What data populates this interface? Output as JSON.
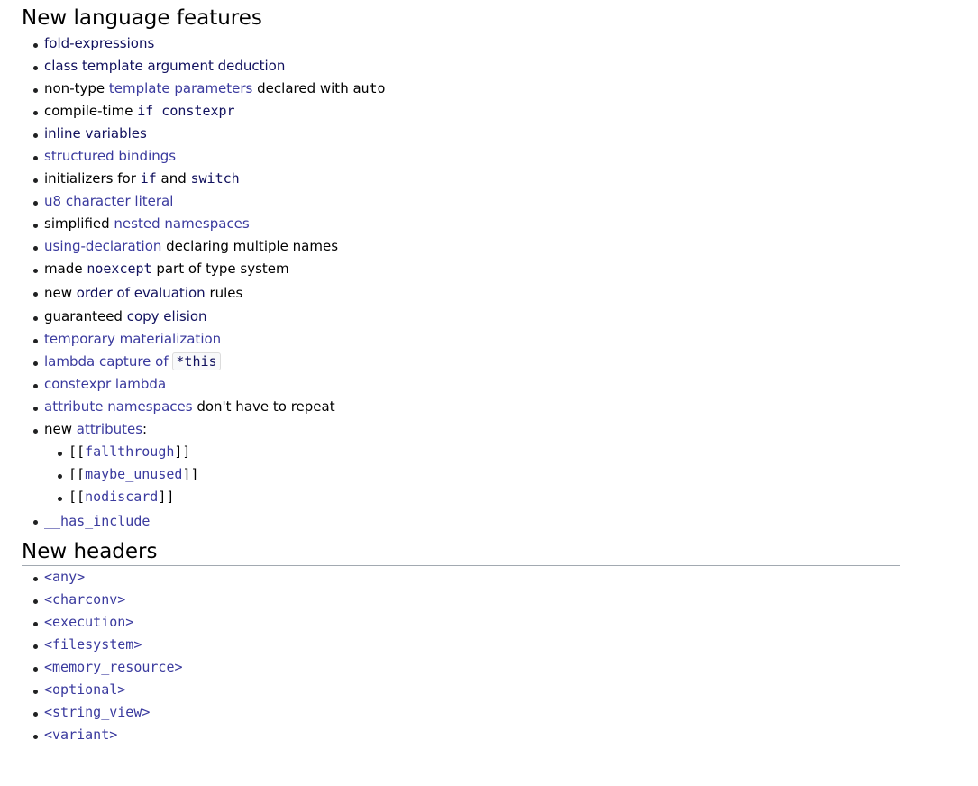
{
  "section_language": {
    "heading": "New language features",
    "items": [
      {
        "t1": "fold-expressions"
      },
      {
        "t1": "class template argument deduction"
      },
      {
        "t1": "non-type ",
        "t2": "template parameters",
        "t3": " declared with ",
        "t4": "auto"
      },
      {
        "t1": "compile-time ",
        "t2": "if constexpr"
      },
      {
        "t1": "inline variables"
      },
      {
        "t1": "structured bindings"
      },
      {
        "t1": "initializers for ",
        "t2": "if",
        "t3": " and ",
        "t4": "switch"
      },
      {
        "t1": "u8 character literal"
      },
      {
        "t1": "simplified ",
        "t2": "nested namespaces"
      },
      {
        "t1": "using-declaration",
        "t2": " declaring multiple names"
      },
      {
        "t1": "made ",
        "t2": "noexcept",
        "t3": " part of type system"
      },
      {
        "t1": "new ",
        "t2": "order of evaluation",
        "t3": " rules"
      },
      {
        "t1": "guaranteed ",
        "t2": "copy elision"
      },
      {
        "t1": "temporary materialization"
      },
      {
        "t1": "lambda capture of ",
        "t2": "*this"
      },
      {
        "t1": "constexpr lambda"
      },
      {
        "t1": "attribute namespaces",
        "t2": " don't have to repeat"
      },
      {
        "t1": "new ",
        "t2": "attributes",
        "t3": ":"
      },
      {
        "t1": "__has_include"
      }
    ],
    "attributes_sub": [
      {
        "open": "[[",
        "name": "fallthrough",
        "close": "]]"
      },
      {
        "open": "[[",
        "name": "maybe_unused",
        "close": "]]"
      },
      {
        "open": "[[",
        "name": "nodiscard",
        "close": "]]"
      }
    ]
  },
  "section_headers": {
    "heading": "New headers",
    "items": [
      "<any>",
      "<charconv>",
      "<execution>",
      "<filesystem>",
      "<memory_resource>",
      "<optional>",
      "<string_view>",
      "<variant>"
    ]
  },
  "colors": {
    "link": "#3a3a9e",
    "link_dark": "#11115e",
    "heading_rule": "#a2a9b1"
  }
}
